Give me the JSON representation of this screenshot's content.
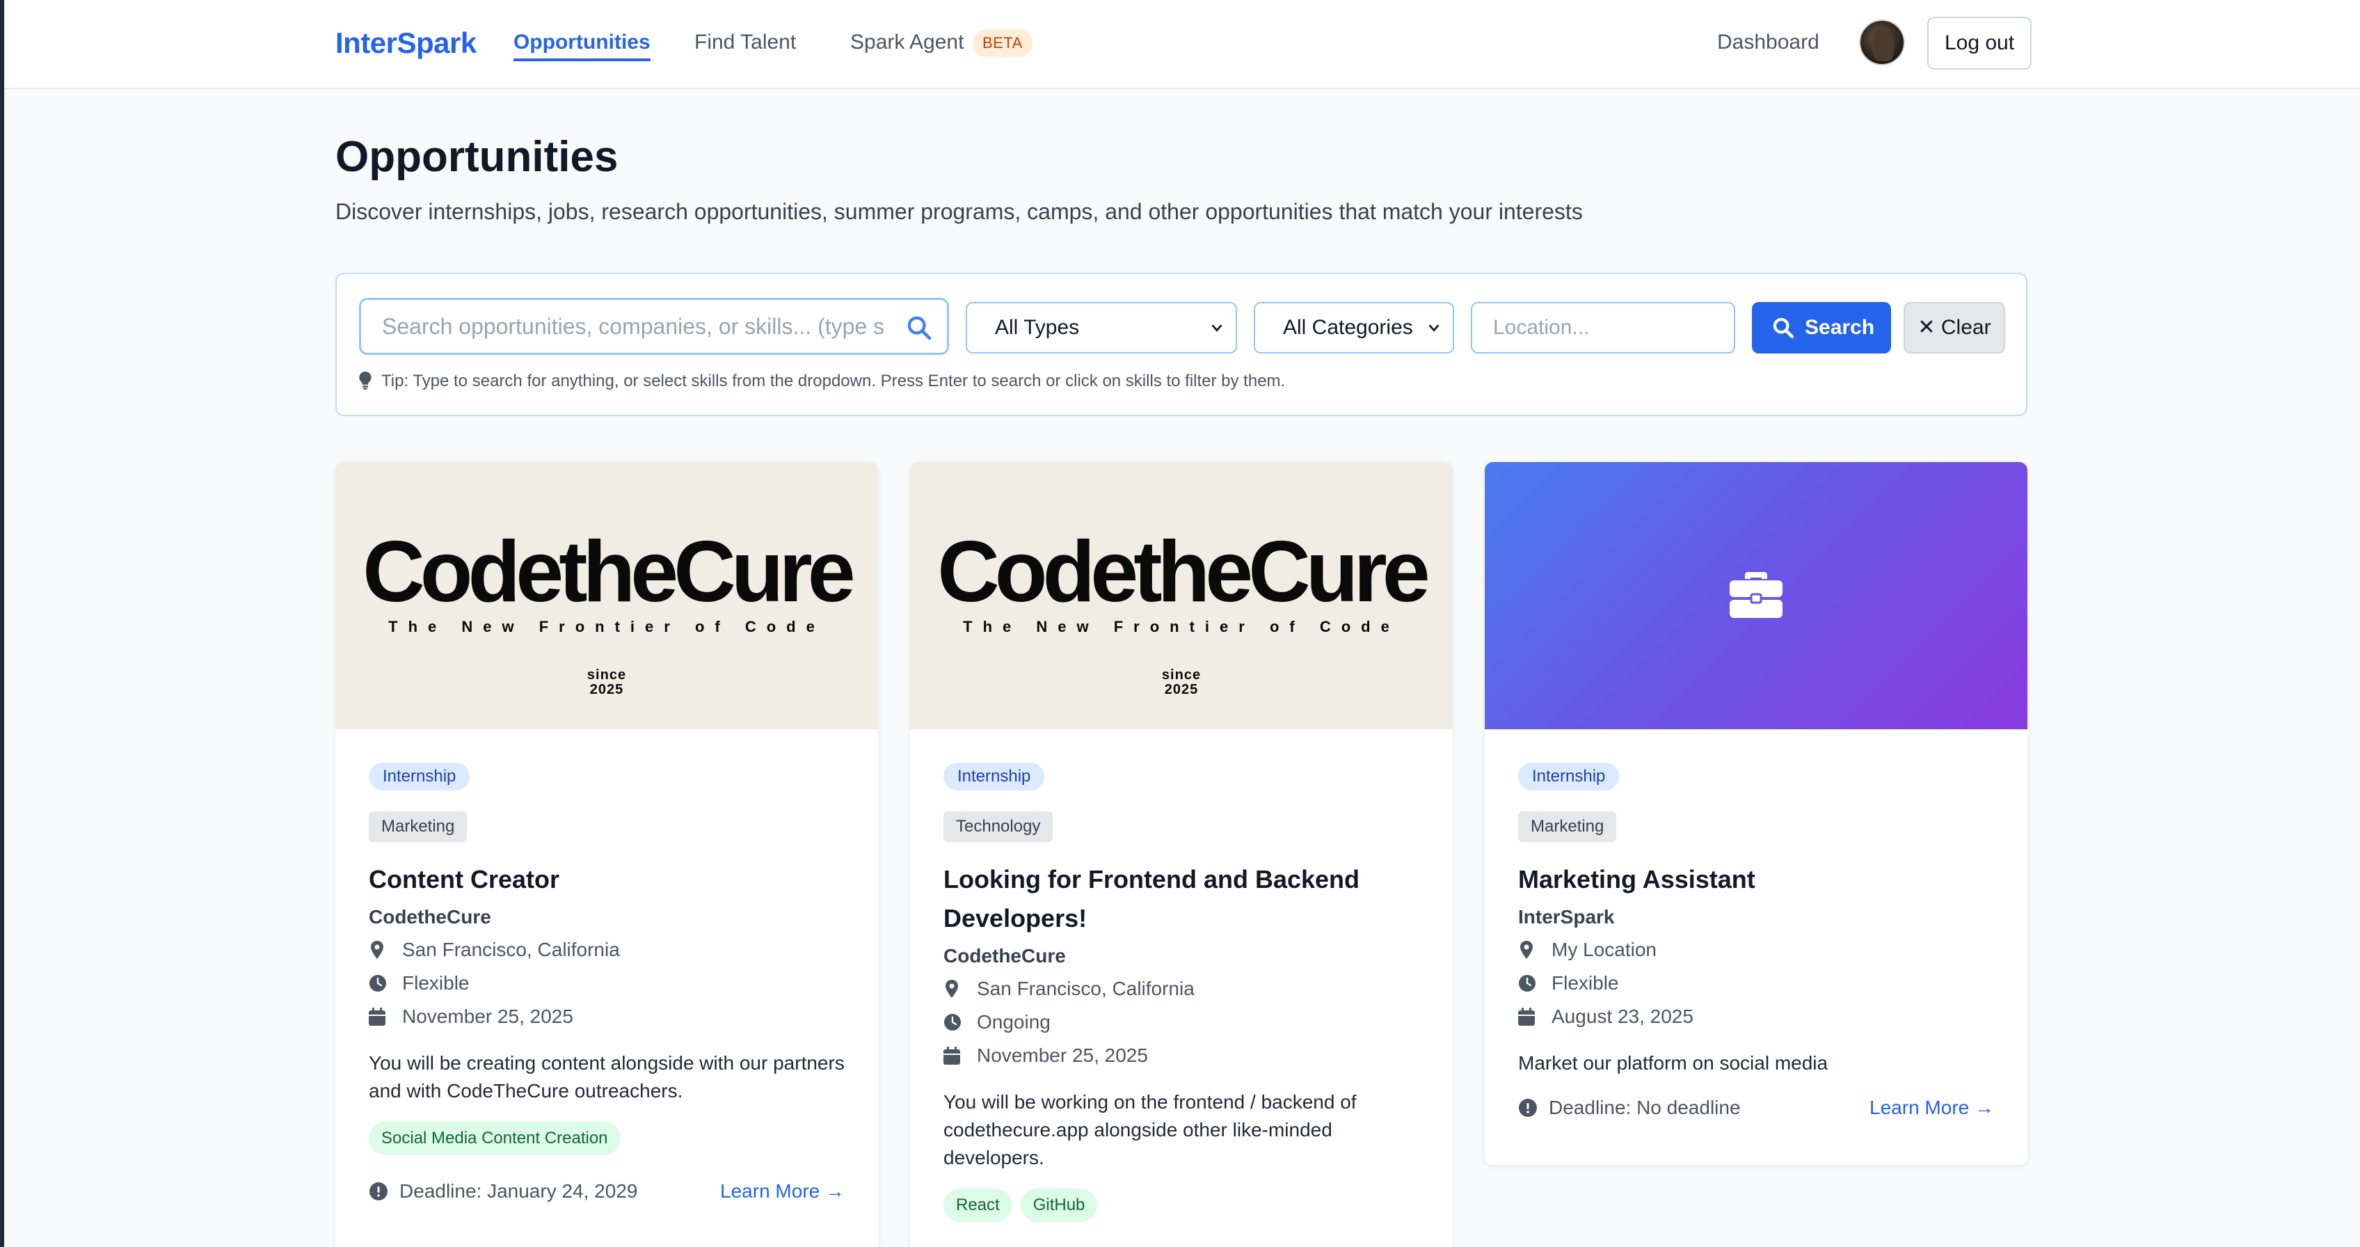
{
  "nav": {
    "logo": "InterSpark",
    "links": [
      "Opportunities",
      "Find Talent",
      "Spark Agent"
    ],
    "beta": "BETA",
    "dashboard": "Dashboard",
    "logout": "Log out"
  },
  "header": {
    "title": "Opportunities",
    "subtitle": "Discover internships, jobs, research opportunities, summer programs, camps, and other opportunities that match your interests"
  },
  "search": {
    "placeholder": "Search opportunities, companies, or skills... (type s",
    "type_select": "All Types",
    "category_select": "All Categories",
    "location_placeholder": "Location...",
    "search_button": "Search",
    "clear_button": "Clear",
    "tip": "Tip: Type to search for anything, or select skills from the dropdown. Press Enter to search or click on skills to filter by them."
  },
  "logo_art": {
    "name": "CodetheCure",
    "tagline": "The New Frontier of Code",
    "since": "since",
    "year": "2025"
  },
  "cards": [
    {
      "type": "Internship",
      "category": "Marketing",
      "title": "Content Creator",
      "company": "CodetheCure",
      "location": "San Francisco, California",
      "schedule": "Flexible",
      "date": "November 25, 2025",
      "description": "You will be creating content alongside with our partners and with CodeTheCure outreachers.",
      "skills": [
        "Social Media Content Creation"
      ],
      "deadline": "Deadline: January 24, 2029",
      "learn_more": "Learn More →"
    },
    {
      "type": "Internship",
      "category": "Technology",
      "title": "Looking for Frontend and Backend Developers!",
      "company": "CodetheCure",
      "location": "San Francisco, California",
      "schedule": "Ongoing",
      "date": "November 25, 2025",
      "description": "You will be working on the frontend / backend of codethecure.app alongside other like-minded developers.",
      "skills": [
        "React",
        "GitHub"
      ]
    },
    {
      "type": "Internship",
      "category": "Marketing",
      "title": "Marketing Assistant",
      "company": "InterSpark",
      "location": "My Location",
      "schedule": "Flexible",
      "date": "August 23, 2025",
      "description": "Market our platform on social media",
      "deadline": "Deadline: No deadline",
      "learn_more": "Learn More →"
    }
  ],
  "colors": {
    "primary": "#2563eb",
    "beta_bg": "#ffedd5",
    "beta_text": "#c2410c",
    "skill_bg": "#dcfce7",
    "skill_text": "#166534"
  }
}
